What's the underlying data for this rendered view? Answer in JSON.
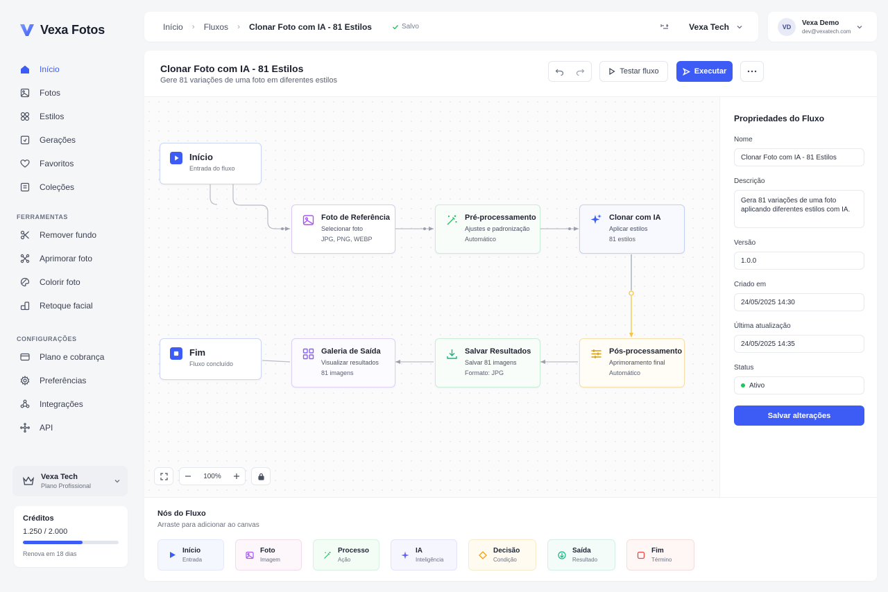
{
  "app": {
    "name": "Vexa Fotos"
  },
  "nav": {
    "main": [
      {
        "label": "Início",
        "icon": "home-icon",
        "active": true
      },
      {
        "label": "Fotos",
        "icon": "image-icon"
      },
      {
        "label": "Estilos",
        "icon": "grid-icon"
      },
      {
        "label": "Gerações",
        "icon": "generation-icon"
      },
      {
        "label": "Favoritos",
        "icon": "heart-icon"
      },
      {
        "label": "Coleções",
        "icon": "collection-icon"
      }
    ],
    "tools_title": "FERRAMENTAS",
    "tools": [
      {
        "label": "Remover fundo",
        "icon": "scissors-icon"
      },
      {
        "label": "Aprimorar foto",
        "icon": "enhance-icon"
      },
      {
        "label": "Colorir foto",
        "icon": "palette-icon"
      },
      {
        "label": "Retoque facial",
        "icon": "face-icon"
      }
    ],
    "settings_title": "CONFIGURAÇÕES",
    "settings": [
      {
        "label": "Plano e cobrança",
        "icon": "card-icon"
      },
      {
        "label": "Preferências",
        "icon": "gear-icon"
      },
      {
        "label": "Integrações",
        "icon": "integration-icon"
      },
      {
        "label": "API",
        "icon": "api-icon"
      }
    ]
  },
  "plan": {
    "name": "Vexa Tech",
    "tier": "Plano Profissional"
  },
  "credits": {
    "title": "Créditos",
    "value": "1.250 / 2.000",
    "fraction": 0.625,
    "renew": "Renova em 18 dias"
  },
  "topbar": {
    "breadcrumb": [
      "Início",
      "Fluxos",
      "Clonar Foto com IA - 81 Estilos"
    ],
    "saved": "Salvo",
    "workspace": "Vexa Tech"
  },
  "user": {
    "initials": "VD",
    "name": "Vexa Demo",
    "email": "dev@vexatech.com"
  },
  "flow": {
    "title": "Clonar Foto com IA - 81 Estilos",
    "description": "Gere 81 variações de uma foto em diferentes estilos",
    "test_label": "Testar fluxo",
    "run_label": "Executar"
  },
  "nodes": {
    "start": {
      "title": "Início",
      "line1": "Entrada do fluxo"
    },
    "reference": {
      "title": "Foto de Referência",
      "line1": "Selecionar foto",
      "line2": "JPG, PNG, WEBP"
    },
    "preprocess": {
      "title": "Pré-processamento",
      "line1": "Ajustes e padronização",
      "line2": "Automático"
    },
    "clone": {
      "title": "Clonar com IA",
      "line1": "Aplicar estilos",
      "line2": "81 estilos"
    },
    "postprocess": {
      "title": "Pós-processamento",
      "line1": "Aprimoramento final",
      "line2": "Automático"
    },
    "save": {
      "title": "Salvar Resultados",
      "line1": "Salvar 81 imagens",
      "line2": "Formato: JPG"
    },
    "gallery": {
      "title": "Galeria de Saída",
      "line1": "Visualizar resultados",
      "line2": "81 imagens"
    },
    "end": {
      "title": "Fim",
      "line1": "Fluxo concluído"
    }
  },
  "zoom": "100%",
  "properties": {
    "title": "Propriedades do Fluxo",
    "name_label": "Nome",
    "name": "Clonar Foto com IA - 81 Estilos",
    "desc_label": "Descrição",
    "desc": "Gera 81 variações de uma foto aplicando diferentes estilos com IA.",
    "version_label": "Versão",
    "version": "1.0.0",
    "created_label": "Criado em",
    "created": "24/05/2025 14:30",
    "updated_label": "Última atualização",
    "updated": "24/05/2025 14:35",
    "status_label": "Status",
    "status": "Ativo",
    "save_label": "Salvar alterações"
  },
  "palette": {
    "title": "Nós do Fluxo",
    "subtitle": "Arraste para adicionar ao canvas",
    "items": [
      {
        "label": "Início",
        "sub": "Entrada",
        "color": "#3d5cf5"
      },
      {
        "label": "Foto",
        "sub": "Imagem",
        "color": "#a855f7"
      },
      {
        "label": "Processo",
        "sub": "Ação",
        "color": "#22c55e"
      },
      {
        "label": "IA",
        "sub": "Inteligência",
        "color": "#6366f1"
      },
      {
        "label": "Decisão",
        "sub": "Condição",
        "color": "#f59e0b"
      },
      {
        "label": "Saída",
        "sub": "Resultado",
        "color": "#10b981"
      },
      {
        "label": "Fim",
        "sub": "Término",
        "color": "#ef4444"
      }
    ]
  }
}
